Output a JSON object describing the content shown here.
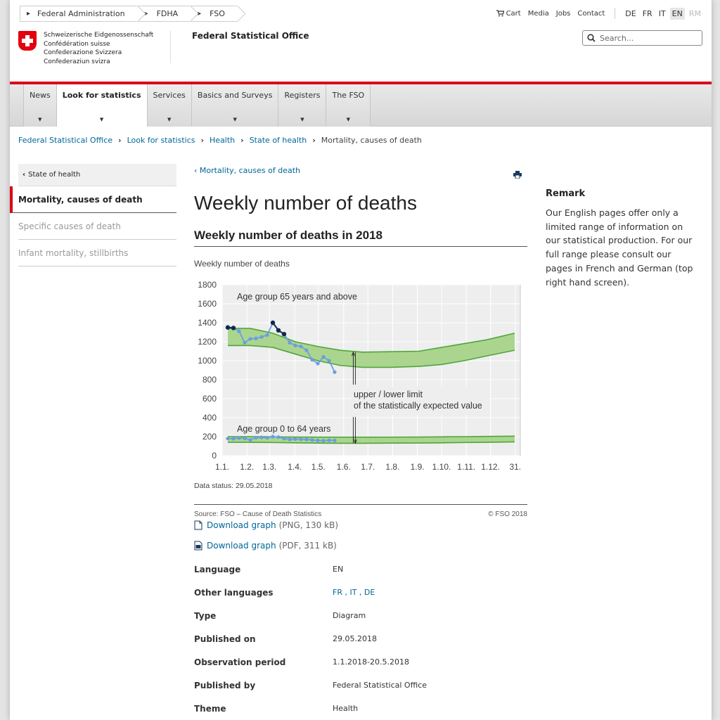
{
  "topbar": {
    "crumbs": [
      "Federal Administration",
      "FDHA",
      "FSO"
    ],
    "links": {
      "cart": "Cart",
      "media": "Media",
      "jobs": "Jobs",
      "contact": "Contact"
    },
    "languages": [
      "DE",
      "FR",
      "IT",
      "EN",
      "RM"
    ],
    "active_language": "EN"
  },
  "header": {
    "logo_lines": [
      "Schweizerische Eidgenossenschaft",
      "Confédération suisse",
      "Confederazione Svizzera",
      "Confederaziun svizra"
    ],
    "office_name": "Federal Statistical Office",
    "search_placeholder": "Search..."
  },
  "nav": {
    "items": [
      "News",
      "Look for statistics",
      "Services",
      "Basics and Surveys",
      "Registers",
      "The FSO"
    ],
    "active": "Look for statistics"
  },
  "breadcrumb": [
    "Federal Statistical Office",
    "Look for statistics",
    "Health",
    "State of health",
    "Mortality, causes of death"
  ],
  "leftnav": {
    "back_label": "State of health",
    "items": [
      "Mortality, causes of death",
      "Specific causes of death",
      "Infant mortality, stillbirths"
    ]
  },
  "main": {
    "back_link": "Mortality, causes of death",
    "title": "Weekly number of deaths",
    "subtitle": "Weekly number of deaths in 2018",
    "source": "Source: FSO – Cause of Death Statistics",
    "copyright": "© FSO 2018",
    "downloads": [
      {
        "label": "Download graph",
        "meta": "(PNG, 130 kB)",
        "icon": "document-icon"
      },
      {
        "label": "Download graph",
        "meta": "(PDF, 311 kB)",
        "icon": "pdf-icon"
      }
    ],
    "properties": [
      {
        "label": "Language",
        "value": "EN"
      },
      {
        "label": "Other languages",
        "value": "FR , IT , DE"
      },
      {
        "label": "Type",
        "value": "Diagram"
      },
      {
        "label": "Published on",
        "value": "29.05.2018"
      },
      {
        "label": "Observation period",
        "value": "1.1.2018-20.5.2018"
      },
      {
        "label": "Published by",
        "value": "Federal Statistical Office"
      },
      {
        "label": "Theme",
        "value": "Health"
      }
    ]
  },
  "remark": {
    "title": "Remark",
    "text": "Our English pages offer only a limited range of information on our statistical production. For our full range please consult our pages in French and German (top right hand screen)."
  },
  "chart_data": {
    "type": "line",
    "title": "",
    "ylabel": "Weekly number of deaths",
    "data_status": "Data status: 29.05.2018",
    "ylim": [
      0,
      1800
    ],
    "yticks": [
      0,
      200,
      400,
      600,
      800,
      1000,
      1200,
      1400,
      1600,
      1800
    ],
    "xlim": [
      0,
      53
    ],
    "xtick_labels": [
      "1.1.",
      "1.2.",
      "1.3.",
      "1.4.",
      "1.5.",
      "1.6.",
      "1.7.",
      "1.8.",
      "1.9.",
      "1.10.",
      "1.11.",
      "1.12.",
      "31."
    ],
    "xtick_weeks": [
      0,
      4.4,
      8.4,
      12.9,
      17.1,
      21.6,
      25.9,
      30.3,
      34.7,
      39.0,
      43.4,
      47.7,
      52.1
    ],
    "grid": true,
    "annotations": {
      "group_65": "Age group 65 years and above",
      "group_0_64": "Age group 0 to 64 years",
      "limits": "upper / lower limit\nof the statistically expected value"
    },
    "colors": {
      "band": "#9fd07e",
      "band_edge": "#4fa53a",
      "line": "#6b9ee0",
      "highlight": "#0f2a4d",
      "plot_bg": "#eeeeee"
    },
    "series": [
      {
        "name": "Age group 65 years and above",
        "week": [
          1,
          2,
          3,
          4,
          5,
          6,
          7,
          8,
          9,
          10,
          11,
          12,
          13,
          14,
          15,
          16,
          17,
          18,
          19,
          20
        ],
        "values": [
          1350,
          1345,
          1310,
          1190,
          1230,
          1235,
          1250,
          1270,
          1400,
          1320,
          1280,
          1190,
          1160,
          1150,
          1110,
          1010,
          970,
          1040,
          1000,
          880
        ],
        "highlight_weeks": [
          1,
          2,
          9,
          10,
          11
        ]
      },
      {
        "name": "Age group 0 to 64 years",
        "week": [
          1,
          2,
          3,
          4,
          5,
          6,
          7,
          8,
          9,
          10,
          11,
          12,
          13,
          14,
          15,
          16,
          17,
          18,
          19,
          20
        ],
        "values": [
          180,
          178,
          185,
          182,
          165,
          190,
          192,
          188,
          200,
          195,
          180,
          170,
          175,
          172,
          170,
          165,
          160,
          158,
          162,
          160
        ]
      }
    ],
    "bands": [
      {
        "name": "65+",
        "week": [
          1,
          5,
          9,
          13,
          17,
          21,
          25,
          30,
          35,
          39,
          43,
          47,
          52
        ],
        "upper": [
          1340,
          1340,
          1290,
          1200,
          1150,
          1110,
          1090,
          1095,
          1100,
          1140,
          1180,
          1220,
          1290
        ],
        "lower": [
          1160,
          1160,
          1140,
          1070,
          1000,
          950,
          930,
          930,
          940,
          960,
          1000,
          1050,
          1110
        ]
      },
      {
        "name": "0-64",
        "week": [
          1,
          5,
          9,
          13,
          17,
          21,
          25,
          30,
          35,
          39,
          43,
          47,
          52
        ],
        "upper": [
          200,
          200,
          198,
          196,
          195,
          195,
          195,
          195,
          196,
          198,
          200,
          202,
          205
        ],
        "lower": [
          140,
          140,
          138,
          135,
          132,
          130,
          130,
          132,
          133,
          135,
          138,
          140,
          145
        ]
      }
    ]
  }
}
